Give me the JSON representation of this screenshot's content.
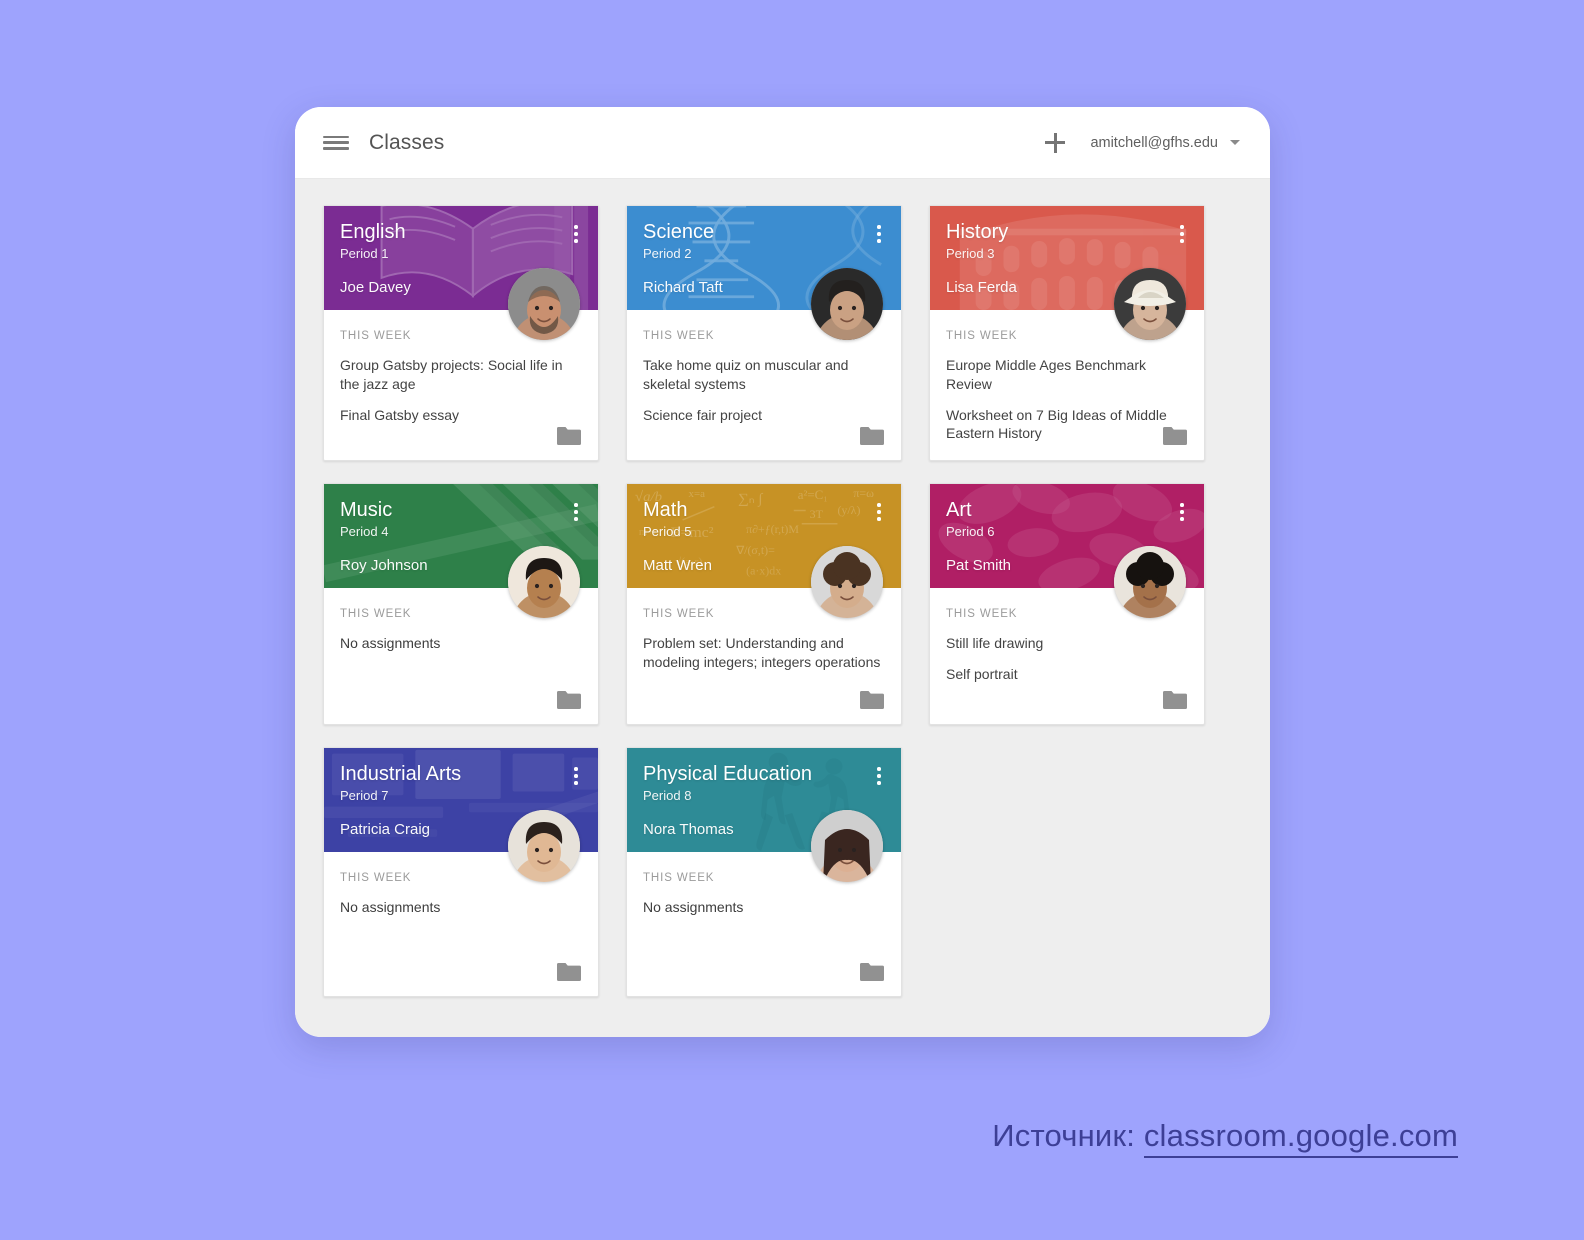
{
  "background_color": "#9ea3fd",
  "header": {
    "menu_icon": "hamburger-menu-icon",
    "title": "Classes",
    "add_icon": "plus-icon",
    "account_email": "amitchell@gfhs.edu",
    "dropdown_icon": "caret-down-icon"
  },
  "labels": {
    "this_week": "THIS WEEK",
    "overflow_icon": "more-vert-icon",
    "folder_icon": "folder-icon"
  },
  "cards": [
    {
      "title": "English",
      "period": "Period 1",
      "teacher": "Joe Davey",
      "color": "#7b2c93",
      "art": "open-book",
      "assignments": [
        "Group Gatsby projects: Social life in the jazz age",
        "Final Gatsby essay"
      ]
    },
    {
      "title": "Science",
      "period": "Period 2",
      "teacher": "Richard Taft",
      "color": "#3c8dd0",
      "art": "dna-helix",
      "assignments": [
        "Take home quiz on muscular and skeletal systems",
        "Science fair project"
      ]
    },
    {
      "title": "History",
      "period": "Period 3",
      "teacher": "Lisa Ferda",
      "color": "#d9594c",
      "art": "colosseum",
      "assignments": [
        "Europe Middle Ages Benchmark Review",
        "Worksheet on 7 Big Ideas of Middle Eastern History"
      ]
    },
    {
      "title": "Music",
      "period": "Period 4",
      "teacher": "Roy Johnson",
      "color": "#2e8049",
      "art": "piano-keys",
      "assignments": [
        "No assignments"
      ]
    },
    {
      "title": "Math",
      "period": "Period 5",
      "teacher": "Matt Wren",
      "color": "#c79225",
      "art": "chalkboard-equations",
      "assignments": [
        "Problem set: Understanding and modeling integers; integers operations"
      ]
    },
    {
      "title": "Art",
      "period": "Period 6",
      "teacher": "Pat Smith",
      "color": "#b01f65",
      "art": "flowers",
      "assignments": [
        "Still life drawing",
        "Self portrait"
      ]
    },
    {
      "title": "Industrial Arts",
      "period": "Period 7",
      "teacher": "Patricia Craig",
      "color": "#3d42a5",
      "art": "workshop",
      "assignments": [
        "No assignments"
      ]
    },
    {
      "title": "Physical Education",
      "period": "Period 8",
      "teacher": "Nora Thomas",
      "color": "#2e8b96",
      "art": "runners",
      "assignments": [
        "No assignments"
      ]
    }
  ],
  "footer": {
    "prefix": "Источник:",
    "link": "classroom.google.com"
  }
}
